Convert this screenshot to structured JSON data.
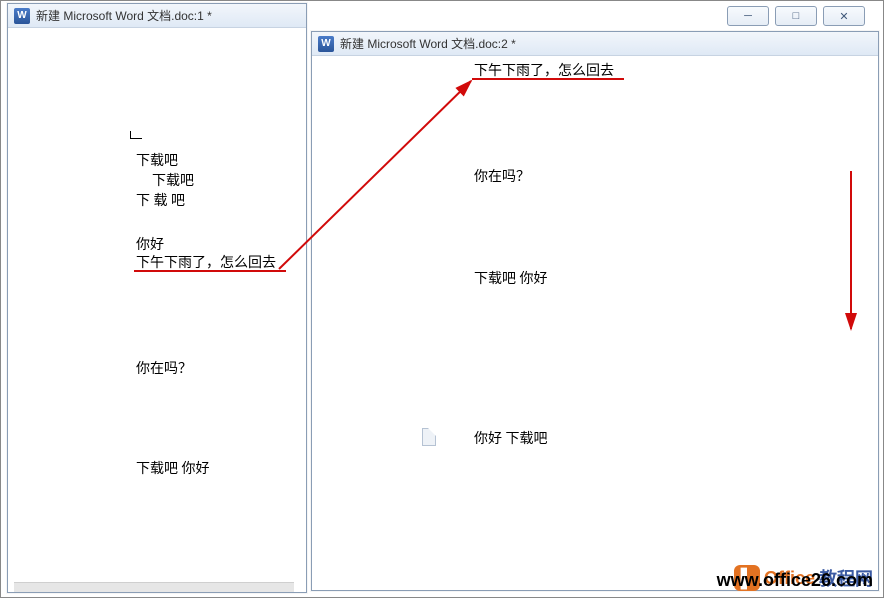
{
  "window_controls": {
    "min": "─",
    "max": "□",
    "close": "✕"
  },
  "win1": {
    "title": "新建 Microsoft Word 文档.doc:1 *",
    "lines": {
      "l1": "下载吧",
      "l2": "下载吧",
      "l3": "下 载   吧",
      "l4": "你好",
      "l5": "下午下雨了，怎么回去",
      "l6": "你在吗？",
      "l7": "下载吧 你好"
    }
  },
  "win2": {
    "title": "新建 Microsoft Word 文档.doc:2 *",
    "lines": {
      "l1": "下午下雨了，怎么回去",
      "l2": "你在吗？",
      "l3": "下载吧 你好",
      "l4": "你好   下载吧"
    }
  },
  "watermark": {
    "brand1": "Office",
    "brand2": "教程网",
    "url": "www.office26.com"
  }
}
